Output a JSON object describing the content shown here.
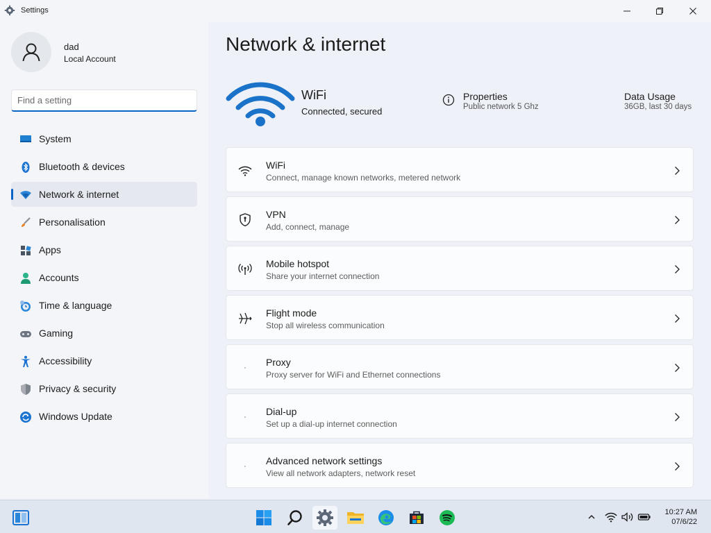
{
  "window": {
    "title": "Settings"
  },
  "account": {
    "name": "dad",
    "type": "Local Account"
  },
  "search": {
    "placeholder": "Find a setting"
  },
  "nav": [
    {
      "label": "System",
      "icon": "system-icon"
    },
    {
      "label": "Bluetooth & devices",
      "icon": "bluetooth-icon"
    },
    {
      "label": "Network & internet",
      "icon": "network-icon",
      "active": true
    },
    {
      "label": "Personalisation",
      "icon": "brush-icon"
    },
    {
      "label": "Apps",
      "icon": "apps-icon"
    },
    {
      "label": "Accounts",
      "icon": "accounts-icon"
    },
    {
      "label": "Time & language",
      "icon": "time-language-icon"
    },
    {
      "label": "Gaming",
      "icon": "gaming-icon"
    },
    {
      "label": "Accessibility",
      "icon": "accessibility-icon"
    },
    {
      "label": "Privacy & security",
      "icon": "shield-icon"
    },
    {
      "label": "Windows Update",
      "icon": "update-icon"
    }
  ],
  "page": {
    "title": "Network & internet"
  },
  "status": {
    "connection_name": "WiFi",
    "connection_status": "Connected, secured",
    "properties_label": "Properties",
    "properties_value": "Public network 5 Ghz",
    "usage_label": "Data Usage",
    "usage_value": "36GB, last 30 days"
  },
  "cards": [
    {
      "title": "WiFi",
      "subtitle": "Connect, manage known networks, metered network",
      "icon": "wifi-icon"
    },
    {
      "title": "VPN",
      "subtitle": "Add, connect, manage",
      "icon": "vpn-shield-icon"
    },
    {
      "title": "Mobile hotspot",
      "subtitle": "Share your internet connection",
      "icon": "hotspot-icon"
    },
    {
      "title": "Flight mode",
      "subtitle": "Stop all wireless communication",
      "icon": "airplane-icon"
    },
    {
      "title": "Proxy",
      "subtitle": "Proxy server for WiFi and Ethernet connections",
      "icon": "proxy-icon"
    },
    {
      "title": "Dial-up",
      "subtitle": "Set up a dial-up internet connection",
      "icon": "dialup-icon"
    },
    {
      "title": "Advanced network settings",
      "subtitle": "View all network adapters, network reset",
      "icon": "advanced-network-icon"
    }
  ],
  "taskbar": {
    "time": "10:27 AM",
    "date": "07/6/22",
    "apps": [
      "start-icon",
      "search-icon",
      "settings-icon",
      "file-explorer-icon",
      "edge-icon",
      "store-icon",
      "spotify-icon"
    ]
  },
  "colors": {
    "accent": "#0a64c8",
    "wifi_blue": "#1a73c8",
    "spotify_green": "#1db954"
  }
}
